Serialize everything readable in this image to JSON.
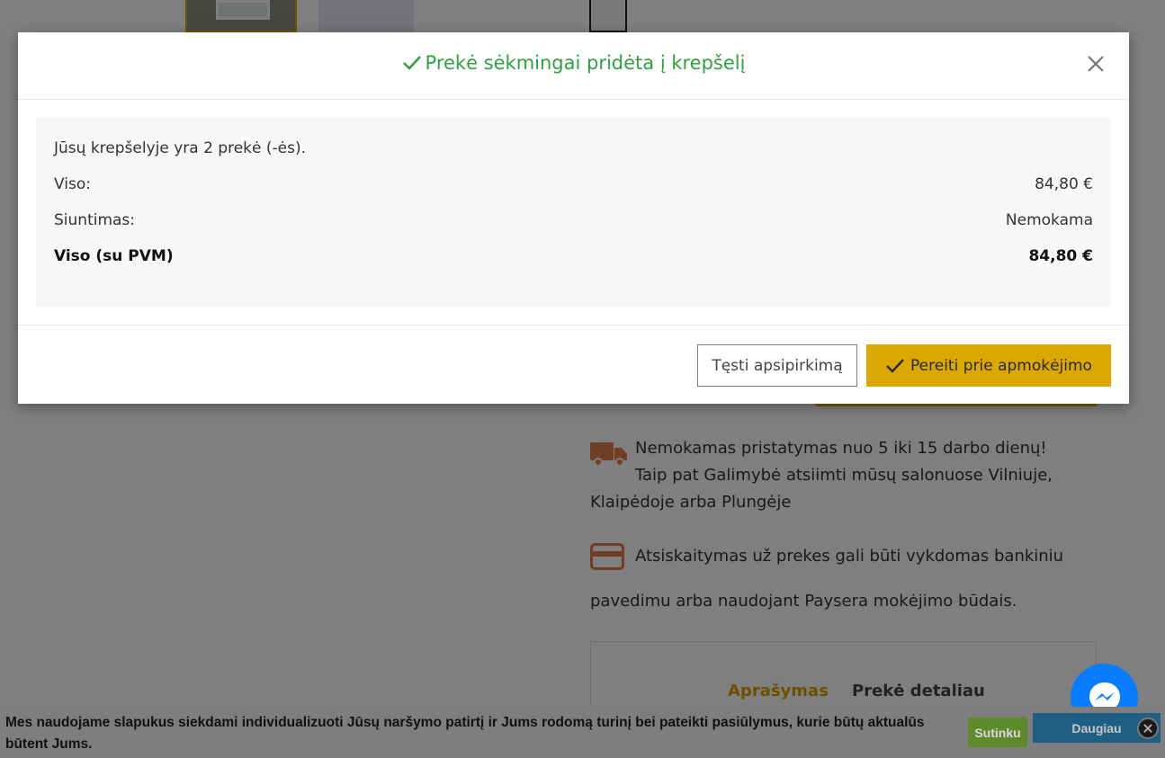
{
  "modal": {
    "title": "Prekė sėkmingai pridėta į krepšelį",
    "cart_count_text": "Jūsų krepšelyje yra 2 prekė (-ės).",
    "subtotal_label": "Viso:",
    "subtotal_value": "84,80 €",
    "shipping_label": "Siuntimas:",
    "shipping_value": "Nemokama",
    "total_label": "Viso (su PVM)",
    "total_value": "84,80 €",
    "continue_label": "Tęsti apsipirkimą",
    "checkout_label": "Pereiti prie apmokėjimo"
  },
  "page": {
    "delivery_line1": "Nemokamas pristatymas nuo 5 iki 15 darbo dienų!",
    "delivery_line2": "Taip pat Galimybė atsiimti mūsų salonuose Vilniuje,",
    "delivery_line3": "Klaipėdoje arba Plungėje",
    "payment_line1": "Atsiskaitymas už prekes gali būti vykdomas bankiniu",
    "payment_line2": "pavedimu arba naudojant Paysera mokėjimo būdais.",
    "tab_description": "Aprašymas",
    "tab_details": "Prekė detaliau"
  },
  "cookie": {
    "text": "Mes naudojame slapukus siekdami individualizuoti Jūsų naršymo patirtį ir Jums rodomą turinį bei pateikti pasiūlymus, kurie būtų aktualūs būtent Jums.",
    "accept_label": "Sutinku",
    "more_label": "Daugiau"
  },
  "colors": {
    "success_green": "#2fa23f",
    "accent_yellow": "#dba800",
    "icon_orange": "#e07a4a",
    "messenger_blue": "#0a7cff"
  },
  "icons": [
    "check-icon",
    "close-icon",
    "truck-icon",
    "credit-card-icon",
    "messenger-icon",
    "cookie-close-icon"
  ]
}
